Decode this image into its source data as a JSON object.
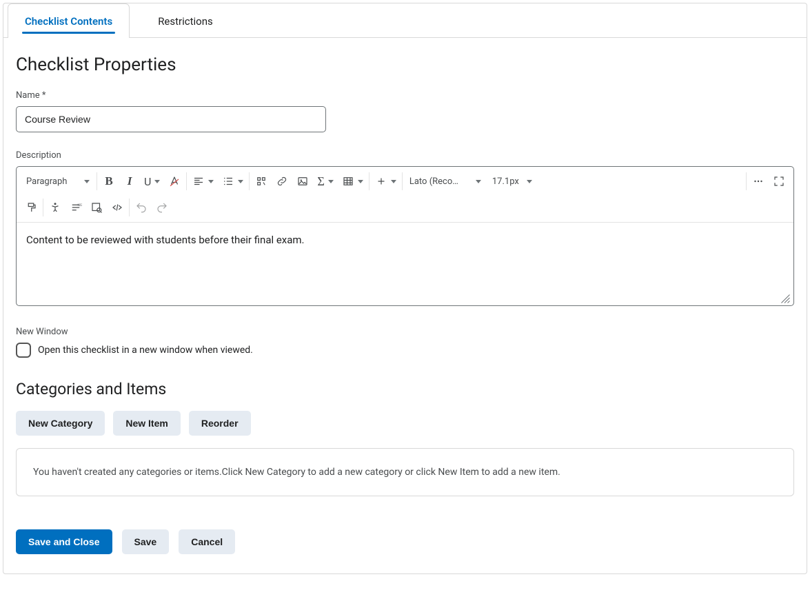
{
  "tabs": {
    "active": "Checklist Contents",
    "inactive": "Restrictions"
  },
  "headings": {
    "properties": "Checklist Properties",
    "categories": "Categories and Items"
  },
  "fields": {
    "name_label": "Name *",
    "name_value": "Course Review",
    "description_label": "Description",
    "description_value": "Content to be reviewed with students before their final exam.",
    "new_window_label": "New Window",
    "new_window_checkbox": "Open this checklist in a new window when viewed."
  },
  "toolbar": {
    "paragraph": "Paragraph",
    "font_family": "Lato (Recomm…",
    "font_size": "17.1px"
  },
  "buttons": {
    "new_category": "New Category",
    "new_item": "New Item",
    "reorder": "Reorder",
    "save_close": "Save and Close",
    "save": "Save",
    "cancel": "Cancel"
  },
  "empty_message": "You haven't created any categories or items.Click New Category to add a new category or click New Item to add a new item."
}
